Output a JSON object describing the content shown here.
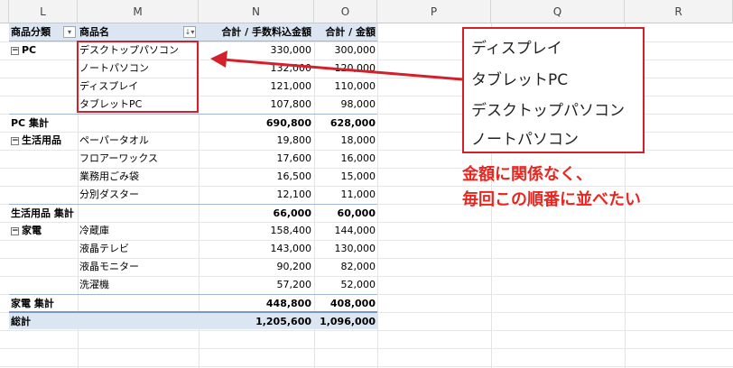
{
  "columns": [
    "L",
    "M",
    "N",
    "O",
    "P",
    "Q",
    "R"
  ],
  "pivot": {
    "headers": {
      "category": "商品分類",
      "product": "商品名",
      "sum_fee": "合計 / 手数料込金額",
      "sum_amount": "合計 / 金額"
    },
    "groups": [
      {
        "name": "PC",
        "rows": [
          {
            "product": "デスクトップパソコン",
            "fee": "330,000",
            "amount": "300,000"
          },
          {
            "product": "ノートパソコン",
            "fee": "132,000",
            "amount": "120,000"
          },
          {
            "product": "ディスプレイ",
            "fee": "121,000",
            "amount": "110,000"
          },
          {
            "product": "タブレットPC",
            "fee": "107,800",
            "amount": "98,000"
          }
        ],
        "subtotal_label": "PC 集計",
        "subtotal_fee": "690,800",
        "subtotal_amount": "628,000"
      },
      {
        "name": "生活用品",
        "rows": [
          {
            "product": "ペーパータオル",
            "fee": "19,800",
            "amount": "18,000"
          },
          {
            "product": "フロアーワックス",
            "fee": "17,600",
            "amount": "16,000"
          },
          {
            "product": "業務用ごみ袋",
            "fee": "16,500",
            "amount": "15,000"
          },
          {
            "product": "分別ダスター",
            "fee": "12,100",
            "amount": "11,000"
          }
        ],
        "subtotal_label": "生活用品 集計",
        "subtotal_fee": "66,000",
        "subtotal_amount": "60,000"
      },
      {
        "name": "家電",
        "rows": [
          {
            "product": "冷蔵庫",
            "fee": "158,400",
            "amount": "144,000"
          },
          {
            "product": "液晶テレビ",
            "fee": "143,000",
            "amount": "130,000"
          },
          {
            "product": "液晶モニター",
            "fee": "90,200",
            "amount": "82,000"
          },
          {
            "product": "洗濯機",
            "fee": "57,200",
            "amount": "52,000"
          }
        ],
        "subtotal_label": "家電 集計",
        "subtotal_fee": "448,800",
        "subtotal_amount": "408,000"
      }
    ],
    "grand_label": "総計",
    "grand_fee": "1,205,600",
    "grand_amount": "1,096,000"
  },
  "callout": {
    "items": [
      "ディスプレイ",
      "タブレットPC",
      "デスクトップパソコン",
      "ノートパソコン"
    ],
    "note_line1": "金額に関係なく、",
    "note_line2": "毎回この順番に並べたい"
  },
  "colors": {
    "accent_red": "#d4202a",
    "note_red": "#e8261f",
    "pivot_header_bg": "#dce6f2"
  }
}
